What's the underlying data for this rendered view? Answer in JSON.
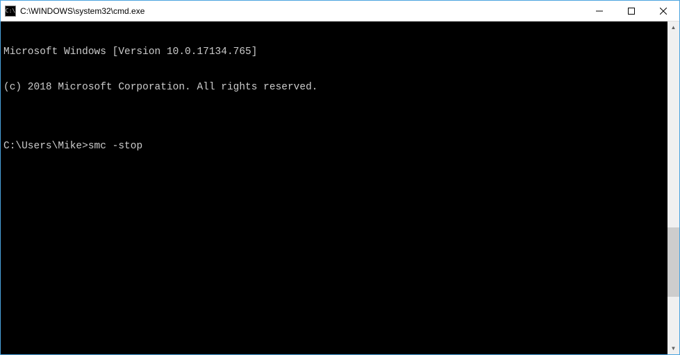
{
  "titlebar": {
    "icon_glyph": "C:\\",
    "title": "C:\\WINDOWS\\system32\\cmd.exe"
  },
  "terminal": {
    "lines": {
      "l0": "Microsoft Windows [Version 10.0.17134.765]",
      "l1": "(c) 2018 Microsoft Corporation. All rights reserved.",
      "l2": "",
      "prompt": "C:\\Users\\Mike>",
      "command": "smc -stop"
    }
  },
  "scrollbar": {
    "up_glyph": "▲",
    "down_glyph": "▼",
    "thumb_top_px": "280",
    "thumb_height_px": "100"
  }
}
